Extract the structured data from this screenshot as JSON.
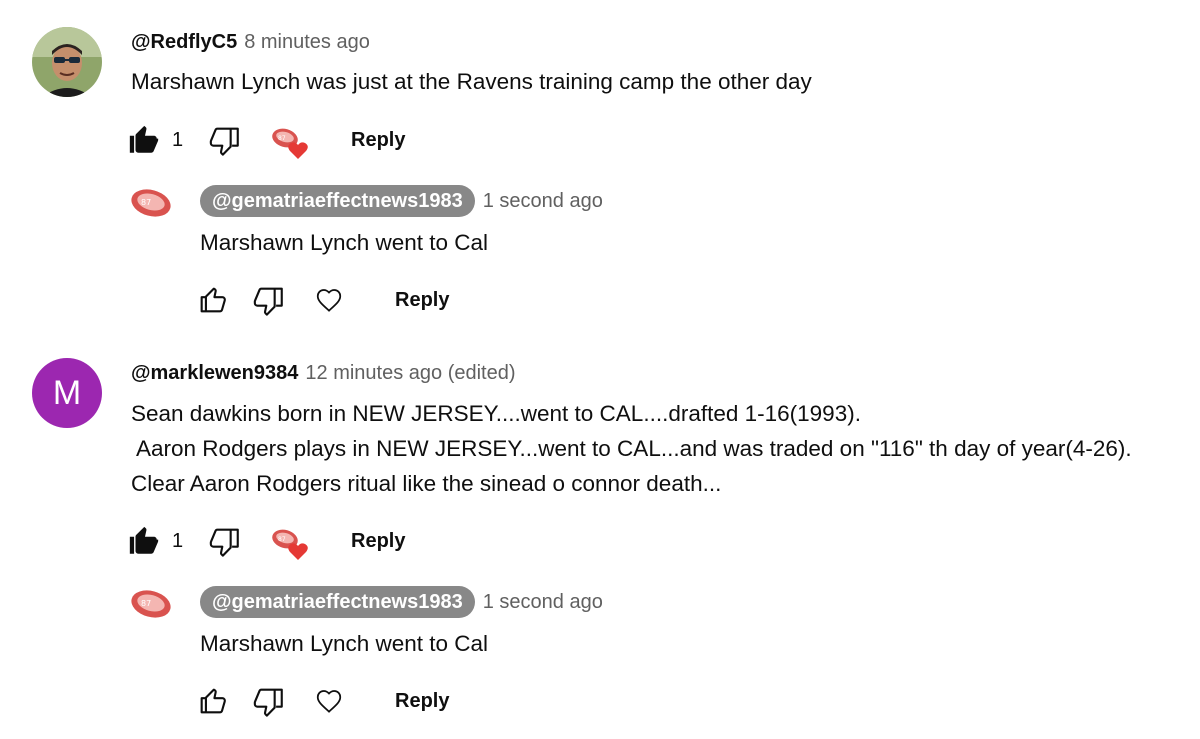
{
  "colors": {
    "accent_purple": "#9c27b0",
    "pill_gray": "#888888",
    "heart_red": "#e53935",
    "text_secondary": "#606060"
  },
  "comments": [
    {
      "author": "@RedflyC5",
      "timestamp": "8 minutes ago",
      "text_lines": [
        "Marshawn Lynch was just at the Ravens training camp the other day"
      ],
      "like_count": "1",
      "reply_label": "Reply",
      "avatar": "photo-avatar",
      "reply": {
        "author": "@gematriaeffectnews1983",
        "timestamp": "1 second ago",
        "text": "Marshawn Lynch went to Cal",
        "reply_label": "Reply"
      }
    },
    {
      "author": "@marklewen9384",
      "timestamp": "12 minutes ago (edited)",
      "avatar_letter": "M",
      "text_lines": [
        "Sean dawkins born in NEW JERSEY....went to CAL....drafted 1-16(1993).",
        " Aaron Rodgers plays in NEW JERSEY...went to CAL...and was traded on \"116\" th day of year(4-26).",
        "Clear Aaron Rodgers ritual like the sinead o connor death..."
      ],
      "like_count": "1",
      "reply_label": "Reply",
      "reply": {
        "author": "@gematriaeffectnews1983",
        "timestamp": "1 second ago",
        "text": "Marshawn Lynch went to Cal",
        "reply_label": "Reply"
      }
    }
  ]
}
